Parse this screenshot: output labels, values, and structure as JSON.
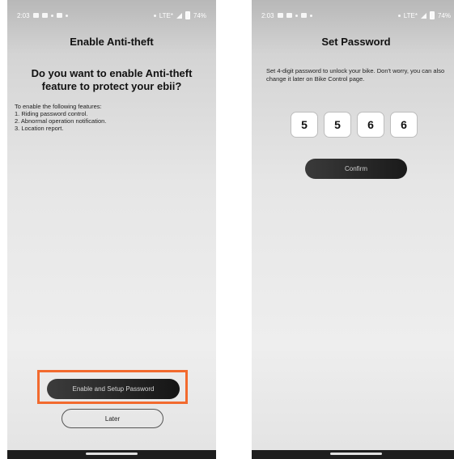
{
  "left_screen": {
    "status": {
      "time": "2:03",
      "network": "LTE*",
      "battery": "74%"
    },
    "title": "Enable Anti-theft",
    "question": "Do you want to enable Anti-theft feature to protect your ebii?",
    "features_intro": "To enable the following features:",
    "features": [
      "1. Riding password control.",
      "2. Abnormal operation notification.",
      "3. Location report."
    ],
    "primary_button": "Enable and Setup Password",
    "secondary_button": "Later"
  },
  "right_screen": {
    "status": {
      "time": "2:03",
      "network": "LTE*",
      "battery": "74%"
    },
    "title": "Set Password",
    "instruction": "Set 4-digit password to unlock your bike. Don't worry, you can also change it later on Bike Control page.",
    "pin_digits": [
      "5",
      "5",
      "6",
      "6"
    ],
    "confirm_button": "Confirm"
  },
  "colors": {
    "highlight": "#f26a2e",
    "button_dark": "#1a1a1a"
  },
  "icons": [
    "wifi-icon",
    "signal-icon",
    "battery-icon",
    "location-icon"
  ]
}
